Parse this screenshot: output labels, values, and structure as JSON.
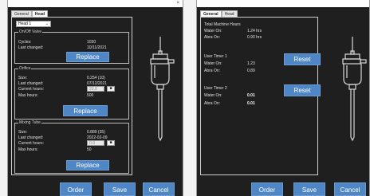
{
  "left_window": {
    "close_glyph": "×",
    "tabs": [
      {
        "label": "General",
        "active": false
      },
      {
        "label": "Head",
        "active": true
      }
    ],
    "head_select": {
      "value": "Head 1",
      "chevron": "⌄"
    },
    "onoff_valve": {
      "title": "On/Off Valve",
      "rows": [
        {
          "label": "Cycles:",
          "value": "1030"
        },
        {
          "label": "Last changed:",
          "value": "10/11/2021"
        }
      ],
      "replace_label": "Replace"
    },
    "orifice": {
      "title": "Orifice",
      "rows": [
        {
          "label": "Size:",
          "value": "0.254 (10)"
        },
        {
          "label": "Last changed:",
          "value": "07/12/2021"
        },
        {
          "label": "Current hours:",
          "value": "23.8"
        },
        {
          "label": "Max hours:",
          "value": "500"
        }
      ],
      "reset_glyph": "■",
      "replace_label": "Replace"
    },
    "mixing_tube": {
      "title": "Mixing Tube",
      "rows": [
        {
          "label": "Size:",
          "value": "0.889 (35)"
        },
        {
          "label": "Last changed:",
          "value": "2022-02-09"
        },
        {
          "label": "Current hours:",
          "value": "0.0"
        },
        {
          "label": "Max hours:",
          "value": "50"
        }
      ],
      "reset_glyph": "■",
      "replace_label": "Replace"
    },
    "buttons": {
      "order": "Order",
      "save": "Save",
      "cancel": "Cancel"
    }
  },
  "right_window": {
    "tabs": [
      {
        "label": "General",
        "active": true
      },
      {
        "label": "Head",
        "active": false
      }
    ],
    "total_machine_hours": {
      "title": "Total Machine Hours",
      "rows": [
        {
          "label": "Water On:",
          "value": "1.24 hrs"
        },
        {
          "label": "Abra On:",
          "value": "0.90 hrs"
        }
      ]
    },
    "user_timer_1": {
      "title": "User Timer 1",
      "rows": [
        {
          "label": "Water On:",
          "value": "1.23"
        },
        {
          "label": "Abra On:",
          "value": "0.89"
        }
      ],
      "reset_label": "Reset"
    },
    "user_timer_2": {
      "title": "User Timer 2",
      "rows": [
        {
          "label": "Water On:",
          "value": "0.01"
        },
        {
          "label": "Abra On:",
          "value": "0.01"
        }
      ],
      "reset_label": "Reset"
    },
    "buttons": {
      "order": "Order",
      "save": "Save",
      "cancel": "Cancel"
    }
  },
  "colors": {
    "window_background": "#1f1f1f",
    "button_blue": "#4f86c6",
    "tool_outline": "#d9d9d9"
  },
  "icons": [
    "close-icon",
    "chevron-down-icon",
    "cutting-head-icon"
  ]
}
